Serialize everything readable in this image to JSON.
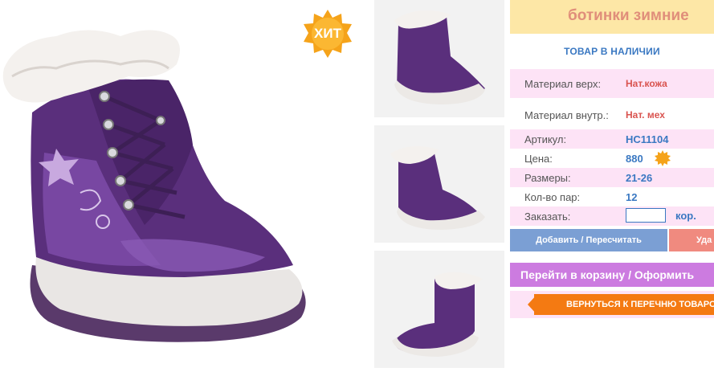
{
  "badge": {
    "hit": "ХИТ"
  },
  "product": {
    "title": "ботинки зимние",
    "stock": "ТОВАР В НАЛИЧИИ",
    "specs": [
      {
        "label": "Материал верх:",
        "value": "Нат.кожа"
      },
      {
        "label": "Материал внутр.:",
        "value": "Нат. мех"
      },
      {
        "label": "Артикул:",
        "value": "HC11104"
      },
      {
        "label": "Цена:",
        "value": "880"
      },
      {
        "label": "Размеры:",
        "value": "21-26"
      },
      {
        "label": "Кол-во пар:",
        "value": "12"
      }
    ],
    "order_label": "Заказать:",
    "order_value": "",
    "order_unit": "кор."
  },
  "buttons": {
    "add": "Добавить / Пересчитать",
    "delete": "Уда",
    "cart": "Перейти в корзину / Оформить",
    "back": "ВЕРНУТЬСЯ К ПЕРЕЧНЮ ТОВАРОВ"
  },
  "colors": {
    "boot": "#5a2f7c",
    "boot_light": "#7b4aa6",
    "accent_orange": "#f47a12",
    "title_bg": "#fde7a6",
    "row_pink": "#fde3f6"
  }
}
